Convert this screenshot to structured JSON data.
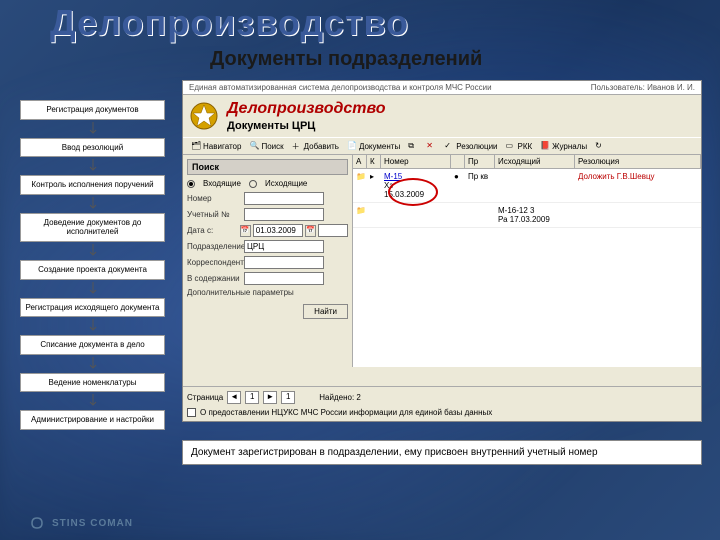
{
  "page": {
    "big_title": "Делопроизводство",
    "subtitle": "Документы подразделений"
  },
  "steps": [
    "Регистрация документов",
    "Ввод резолюций",
    "Контроль исполнения поручений",
    "Доведение документов до исполнителей",
    "Создание проекта документа",
    "Регистрация исходящего документа",
    "Списание документа в дело",
    "Ведение номенклатуры",
    "Администрирование и настройки"
  ],
  "app": {
    "top_system": "Единая автоматизированная система делопроизводства и контроля МЧС России",
    "top_user": "Пользователь: Иванов И. И.",
    "title": "Делопроизводство",
    "subtitle": "Документы ЦРЦ"
  },
  "toolbar": {
    "nav": "Навигатор",
    "search": "Поиск",
    "add": "Добавить",
    "doc": "Документы",
    "del_icon": "✕",
    "res": "Резолюции",
    "rkk": "РКК",
    "jrn": "Журналы"
  },
  "search": {
    "panel_title": "Поиск",
    "radio1": "Входящие",
    "radio2": "Исходящие",
    "lbl_number": "Номер",
    "lbl_account": "Учетный №",
    "lbl_date_from": "Дата с:",
    "date_from": "01.03.2009",
    "lbl_division": "Подразделение",
    "division": "ЦРЦ",
    "lbl_corr": "Корреспондент",
    "lbl_content": "В содержании",
    "lbl_extra": "Дополнительные параметры",
    "find_btn": "Найти"
  },
  "columns": {
    "a": "А",
    "k": "К",
    "num": "Номер",
    "ctrl": "",
    "pr": "Пр",
    "out": "Исходящий",
    "res": "Резолюция"
  },
  "docs": [
    {
      "num": "М-15",
      "from": "Хз",
      "date": "15.03.2009",
      "pr": "Пр кв",
      "out": "",
      "res": "Доложить Г.В.Шевцу"
    },
    {
      "num": "",
      "from": "",
      "date": "",
      "pr": "",
      "out": "М-16-12 3\nРа 17.03.2009",
      "res": ""
    }
  ],
  "pager": {
    "lbl_page": "Страница",
    "page": "1",
    "total": "1",
    "lbl_found": "Найдено: 2"
  },
  "note": {
    "text": "О предоставлении НЦУКС МЧС России информации для единой базы данных"
  },
  "caption": "Документ зарегистрирован в подразделении, ему присвоен внутренний учетный номер",
  "footer": "STINS COMAN"
}
